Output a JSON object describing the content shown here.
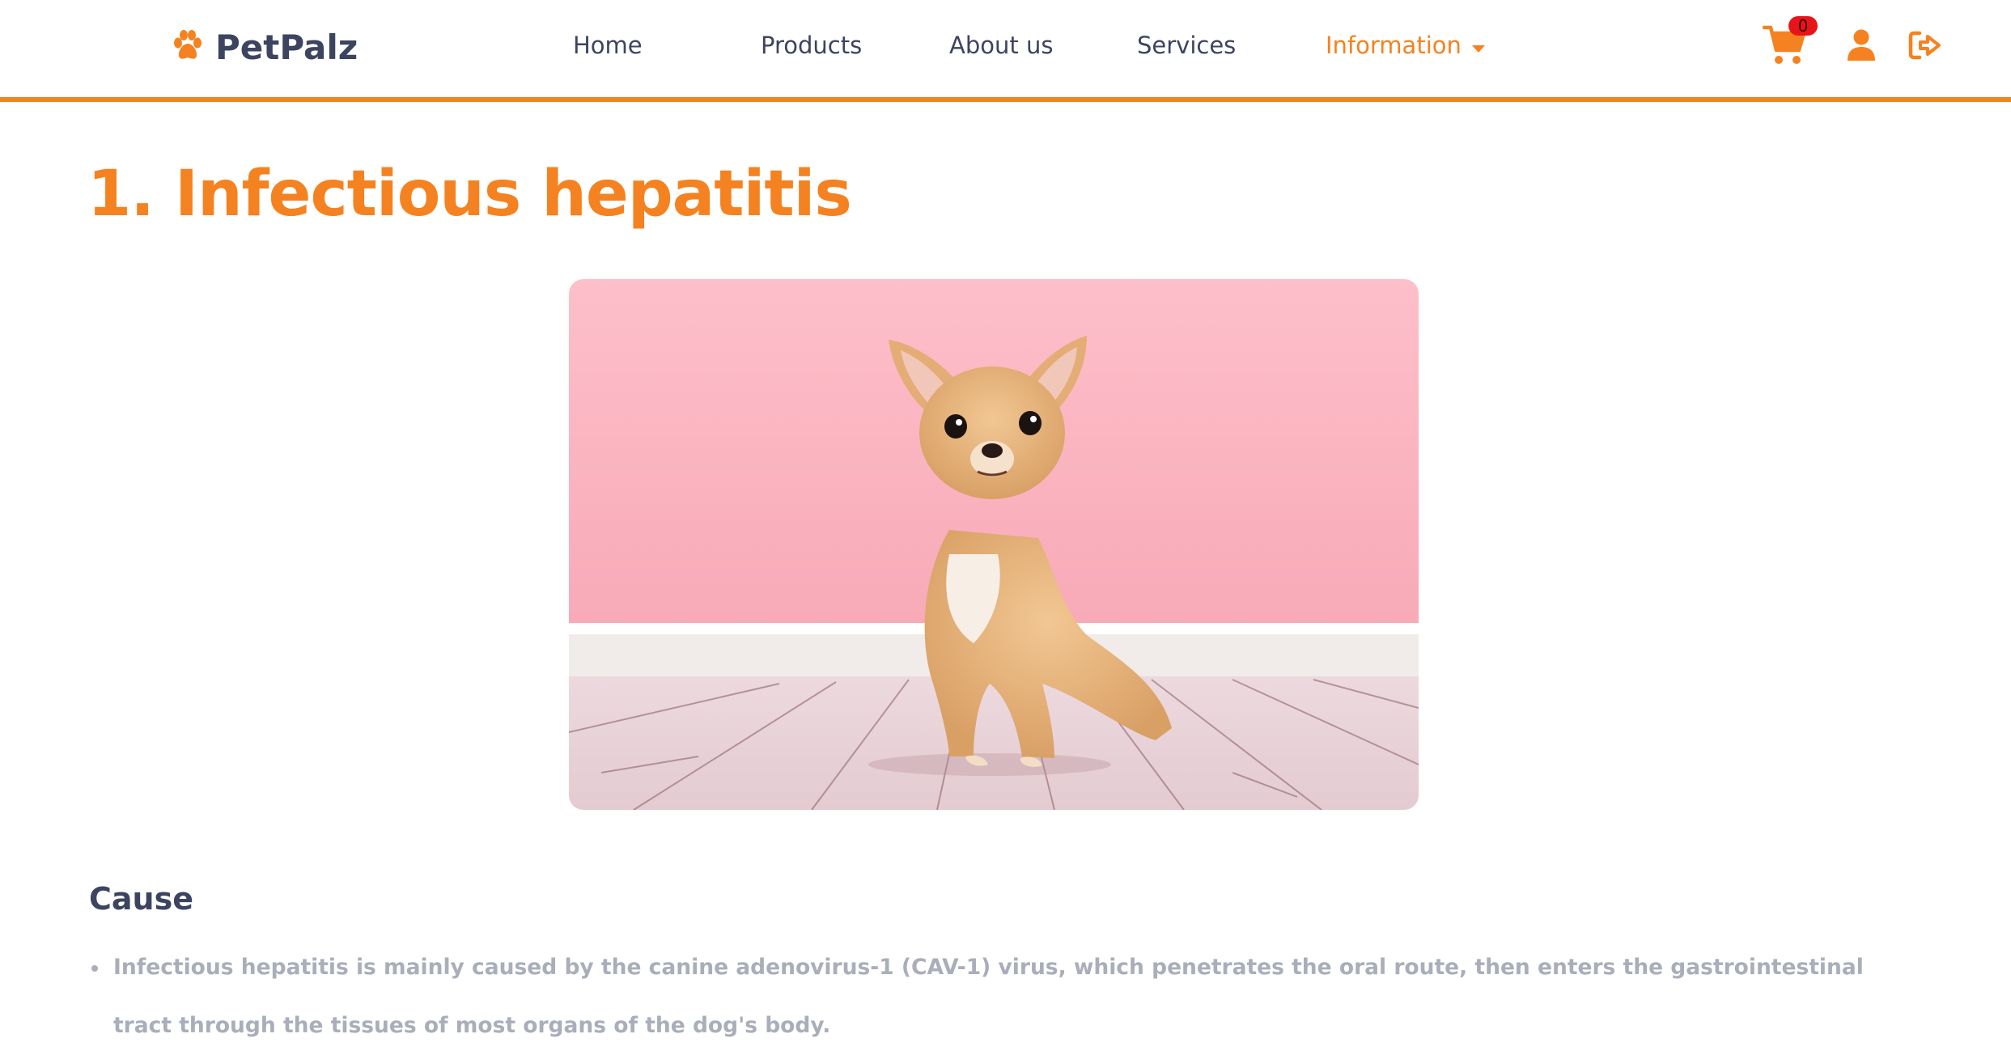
{
  "brand": {
    "name": "PetPalz",
    "logo_icon": "paw-icon",
    "accent_color": "#f58220",
    "text_color": "#3d4460"
  },
  "nav": {
    "items": [
      {
        "label": "Home"
      },
      {
        "label": "Products"
      },
      {
        "label": "About us"
      },
      {
        "label": "Services"
      },
      {
        "label": "Information",
        "active": true,
        "icon": "caret-down-icon"
      }
    ]
  },
  "header_actions": {
    "cart": {
      "icon": "cart-icon",
      "count": "0",
      "badge_color": "#e8141a"
    },
    "account": {
      "icon": "user-icon"
    },
    "logout": {
      "icon": "sign-out-icon"
    }
  },
  "article": {
    "title": "1. Infectious hepatitis",
    "image": {
      "subject": "chihuahua-photo"
    },
    "sections": [
      {
        "heading": "Cause",
        "bullets": [
          "Infectious hepatitis is mainly caused by the canine adenovirus-1 (CAV-1) virus, which penetrates the oral route, then enters the gastrointestinal tract through the tissues of most organs of the dog's body."
        ]
      }
    ]
  }
}
